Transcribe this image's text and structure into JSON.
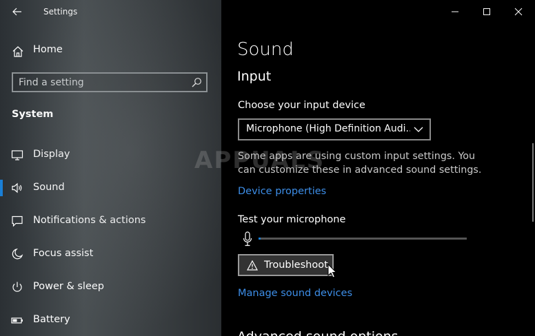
{
  "window": {
    "app_title": "Settings",
    "back_icon": "back-arrow-icon",
    "caption_buttons": [
      "minimize-icon",
      "maximize-icon",
      "close-icon"
    ]
  },
  "nav": {
    "home_label": "Home",
    "home_icon": "home-icon",
    "search": {
      "placeholder": "Find a setting",
      "value": "",
      "icon": "search-icon"
    },
    "section_label": "System",
    "items": [
      {
        "label": "Display",
        "icon": "display-icon",
        "selected": false
      },
      {
        "label": "Sound",
        "icon": "speaker-icon",
        "selected": true
      },
      {
        "label": "Notifications & actions",
        "icon": "notification-icon",
        "selected": false
      },
      {
        "label": "Focus assist",
        "icon": "moon-icon",
        "selected": false
      },
      {
        "label": "Power & sleep",
        "icon": "power-icon",
        "selected": false
      },
      {
        "label": "Battery",
        "icon": "battery-icon",
        "selected": false
      }
    ],
    "accent_color": "#1a7fd6"
  },
  "main": {
    "page_title": "Sound",
    "section_title": "Input",
    "device_label": "Choose your input device",
    "device_value": "Microphone (High Definition Audi...",
    "info_text": "Some apps are using custom input settings. You can customize these in advanced sound settings.",
    "device_properties_link": "Device properties",
    "test_label": "Test your microphone",
    "mic_level": 0.01,
    "troubleshoot_label": "Troubleshoot",
    "manage_link": "Manage sound devices",
    "next_section_partial": "Advanced sound options",
    "link_color": "#3d8ee8"
  },
  "watermark": "APPUALS"
}
